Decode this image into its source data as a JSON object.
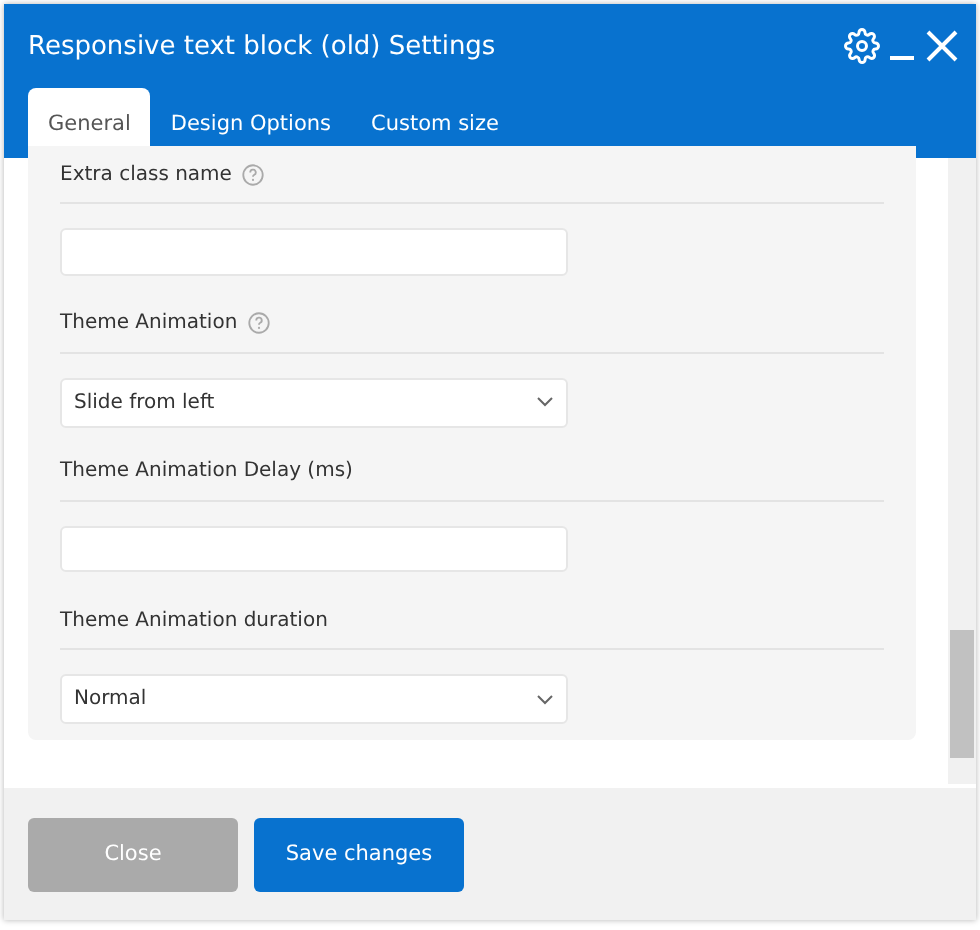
{
  "window": {
    "title": "Responsive text block (old) Settings"
  },
  "tabs": [
    {
      "label": "General",
      "selected": true
    },
    {
      "label": "Design Options",
      "selected": false
    },
    {
      "label": "Custom size",
      "selected": false
    }
  ],
  "fields": [
    {
      "label": "Extra class name",
      "help": true,
      "kind": "text"
    },
    {
      "label": "Theme Animation",
      "help": true,
      "kind": "select",
      "value": "Slide from left"
    },
    {
      "label": "Theme Animation Delay (ms)",
      "help": false,
      "kind": "text"
    },
    {
      "label": "Theme Animation duration",
      "help": false,
      "kind": "select",
      "value": "Normal"
    }
  ],
  "buttons": [
    {
      "label": "Close",
      "kind": "secondary",
      "disabled": true
    },
    {
      "label": "Save changes",
      "kind": "primary",
      "disabled": false
    }
  ]
}
